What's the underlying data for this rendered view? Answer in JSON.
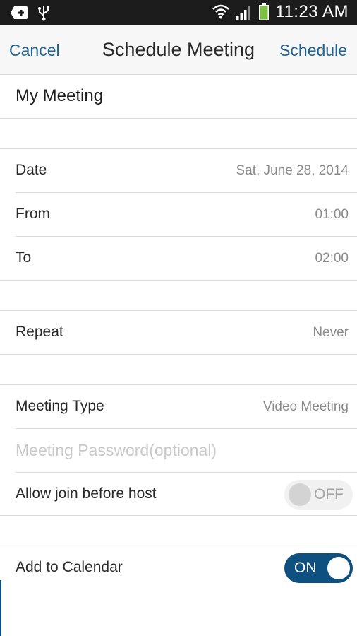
{
  "status_bar": {
    "time": "11:23 AM",
    "icons": [
      "notification-add-icon",
      "usb-icon",
      "wifi-icon",
      "signal-icon",
      "battery-icon"
    ]
  },
  "nav": {
    "cancel_label": "Cancel",
    "title": "Schedule Meeting",
    "schedule_label": "Schedule"
  },
  "meeting": {
    "title": "My Meeting"
  },
  "fields": {
    "date": {
      "label": "Date",
      "value": "Sat, June 28, 2014"
    },
    "from": {
      "label": "From",
      "value": "01:00"
    },
    "to": {
      "label": "To",
      "value": "02:00"
    },
    "repeat": {
      "label": "Repeat",
      "value": "Never"
    },
    "meeting_type": {
      "label": "Meeting Type",
      "value": "Video Meeting"
    },
    "password": {
      "placeholder": "Meeting Password(optional)"
    },
    "join_before_host": {
      "label": "Allow join before host",
      "toggle": "OFF",
      "enabled": false
    },
    "add_to_calendar": {
      "label": "Add to Calendar",
      "toggle": "ON",
      "enabled": true
    }
  },
  "colors": {
    "accent": "#1f6391",
    "toggle_on": "#0e5080",
    "status_bar": "#1c1c1c",
    "battery": "#7bc043"
  }
}
